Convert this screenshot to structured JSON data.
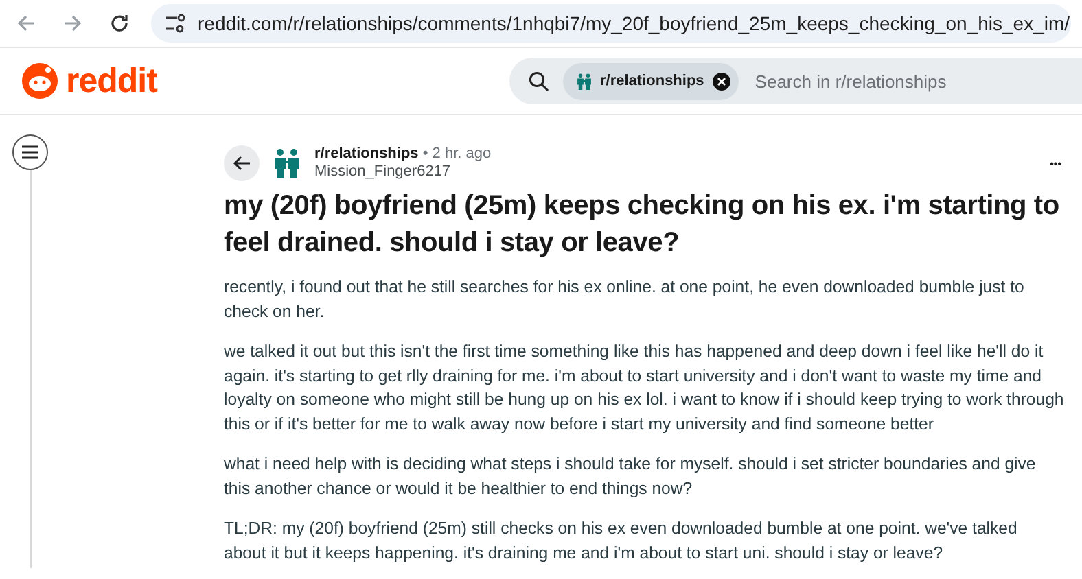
{
  "browser": {
    "url": "reddit.com/r/relationships/comments/1nhqbi7/my_20f_boyfriend_25m_keeps_checking_on_his_ex_im/"
  },
  "header": {
    "logo": "reddit",
    "search": {
      "chip": "r/relationships",
      "placeholder": "Search in r/relationships"
    }
  },
  "post": {
    "subreddit": "r/relationships",
    "separator": "•",
    "time": "2 hr. ago",
    "author": "Mission_Finger6217",
    "more": "•••",
    "title": "my (20f) boyfriend (25m) keeps checking on his ex. i'm starting to feel drained. should i stay or leave?",
    "paragraphs": [
      "recently, i found out that he still searches for his ex online. at one point, he even downloaded bumble just to check on her.",
      "we talked it out but this isn't the first time something like this has happened and deep down i feel like he'll do it again. it's starting to get rlly draining for me. i'm about to start university and i don't want to waste my time and loyalty on someone who might still be hung up on his ex lol. i want to know if i should keep trying to work through this or if it's better for me to walk away now before i start my university and find someone better",
      "what i need help with is deciding what steps i should take for myself. should i set stricter boundaries and give this another chance or would it be healthier to end things now?",
      "TL;DR: my (20f) boyfriend (25m) still checks on his ex even downloaded bumble at one point. we've talked about it but it keeps happening. it's draining me and i'm about to start uni. should i stay or leave?"
    ]
  }
}
